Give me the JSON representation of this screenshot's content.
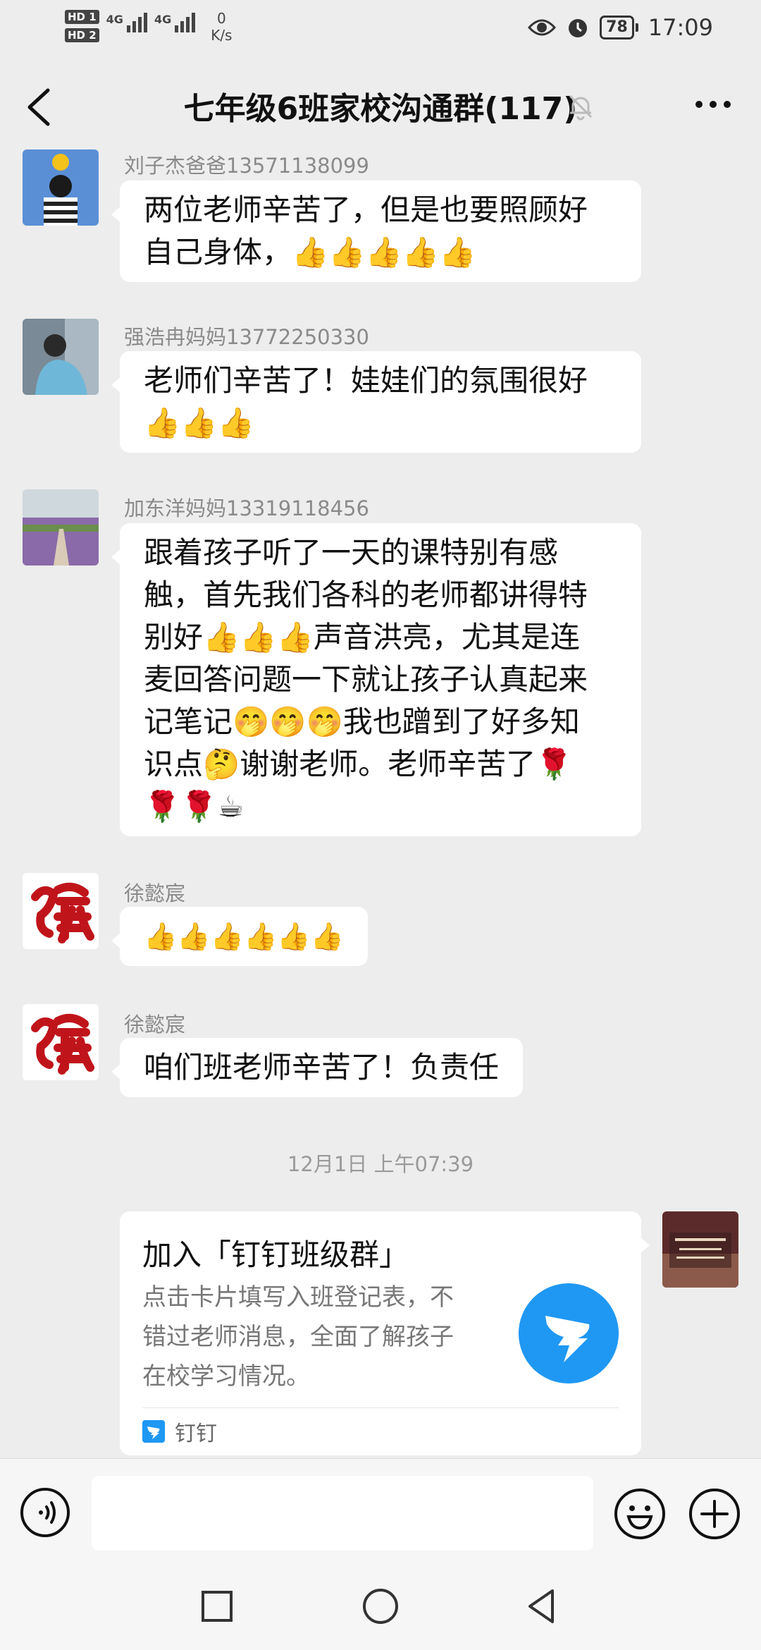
{
  "status_bar": {
    "hd1": "HD 1",
    "hd2": "HD 2",
    "signal1_label": "4G",
    "signal2_label": "4G",
    "speed_value": "0",
    "speed_unit": "K/s",
    "battery": "78",
    "time": "17:09"
  },
  "header": {
    "title": "七年级6班家校沟通群(117)"
  },
  "messages": [
    {
      "sender": "刘子杰爸爸13571138099",
      "lines": [
        "两位老师辛苦了，但是也要照顾好",
        "自己身体，👍👍👍👍👍"
      ]
    },
    {
      "sender": "强浩冉妈妈13772250330",
      "lines": [
        "老师们辛苦了！娃娃们的氛围很好",
        "👍👍👍"
      ]
    },
    {
      "sender": "加东洋妈妈13319118456",
      "lines": [
        "跟着孩子听了一天的课特别有感",
        "触，首先我们各科的老师都讲得特",
        "别好👍👍👍声音洪亮，尤其是连",
        "麦回答问题一下就让孩子认真起来",
        "记笔记🤭🤭🤭我也蹭到了好多知",
        "识点🤔谢谢老师。老师辛苦了🌹",
        "🌹🌹☕"
      ]
    },
    {
      "sender": "徐懿宸",
      "lines": [
        "👍👍👍👍👍👍"
      ]
    },
    {
      "sender": "徐懿宸",
      "lines": [
        "咱们班老师辛苦了！负责任"
      ]
    }
  ],
  "timestamp": "12月1日 上午07:39",
  "card": {
    "title": "加入「钉钉班级群」",
    "desc_lines": [
      "点击卡片填写入班登记表，不",
      "错过老师消息，全面了解孩子",
      "在校学习情况。"
    ],
    "source": "钉钉",
    "brand_color": "#1f98f3"
  },
  "input": {
    "placeholder": ""
  },
  "colors": {
    "background": "#ededed",
    "bubble": "#ffffff",
    "sender_text": "#8a8a8a",
    "fu_red": "#c0141b"
  }
}
